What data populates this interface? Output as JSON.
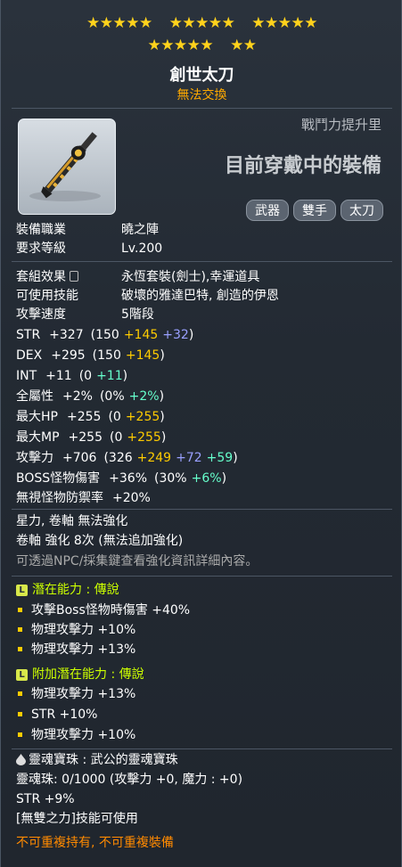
{
  "stars": {
    "row1": [
      "★★★★★",
      "★★★★★",
      "★★★★★"
    ],
    "row2": [
      "★★★★★",
      "★★"
    ]
  },
  "item": {
    "name": "創世太刀",
    "trade": "無法交換",
    "cp_label": "戰鬥力提升里",
    "equipped": "目前穿戴中的裝備",
    "tags": [
      "武器",
      "雙手",
      "太刀"
    ]
  },
  "req": [
    {
      "label": "裝備職業",
      "value": "曉之陣"
    },
    {
      "label": "要求等級",
      "value": "Lv.200"
    }
  ],
  "props": [
    {
      "label": "套組效果",
      "value": "永恆套裝(劍士),幸運道具"
    },
    {
      "label": "可使用技能",
      "value": "破壞的雅達巴特, 創造的伊恩"
    },
    {
      "label": "攻擊速度",
      "value": "5階段"
    }
  ],
  "stats": [
    {
      "label": "STR",
      "total": "+327",
      "open": "(150",
      "parts": [
        {
          "text": "+145",
          "c": "yel"
        },
        {
          "text": "+32",
          "c": "blu"
        }
      ],
      "close": ")"
    },
    {
      "label": "DEX",
      "total": "+295",
      "open": "(150",
      "parts": [
        {
          "text": "+145",
          "c": "yel"
        }
      ],
      "close": ")"
    },
    {
      "label": "INT",
      "total": "+11",
      "open": "(0",
      "parts": [
        {
          "text": "+11",
          "c": "grn"
        }
      ],
      "close": ")"
    },
    {
      "label": "全屬性",
      "total": "+2%",
      "open": "(0%",
      "parts": [
        {
          "text": "+2%",
          "c": "grn"
        }
      ],
      "close": ")"
    },
    {
      "label": "最大HP",
      "total": "+255",
      "open": "(0",
      "parts": [
        {
          "text": "+255",
          "c": "yel"
        }
      ],
      "close": ")"
    },
    {
      "label": "最大MP",
      "total": "+255",
      "open": "(0",
      "parts": [
        {
          "text": "+255",
          "c": "yel"
        }
      ],
      "close": ")"
    },
    {
      "label": "攻擊力",
      "total": "+706",
      "open": "(326",
      "parts": [
        {
          "text": "+249",
          "c": "yel"
        },
        {
          "text": "+72",
          "c": "blu"
        },
        {
          "text": "+59",
          "c": "grn"
        }
      ],
      "close": ")"
    },
    {
      "label": "BOSS怪物傷害",
      "total": "+36%",
      "open": "(30%",
      "parts": [
        {
          "text": "+6%",
          "c": "grn"
        }
      ],
      "close": ")"
    },
    {
      "label": "無視怪物防禦率",
      "total": "+20%",
      "open": "",
      "parts": [],
      "close": ""
    }
  ],
  "enhance": {
    "line1": "星力, 卷軸 無法強化",
    "line2": "卷軸 強化 8次 (無法追加強化)",
    "line3": "可透過NPC/採集鍵查看強化資訊詳細內容。"
  },
  "potential": {
    "badge": "L",
    "title": "潛在能力 : 傳說",
    "lines": [
      "攻擊Boss怪物時傷害 +40%",
      "物理攻擊力 +10%",
      "物理攻擊力 +13%"
    ]
  },
  "bonus_potential": {
    "badge": "L",
    "title": "附加潛在能力 : 傳說",
    "lines": [
      "物理攻擊力 +13%",
      "STR +10%",
      "物理攻擊力 +10%"
    ]
  },
  "soul": {
    "title": "靈魂寶珠 : 武公的靈魂寶珠",
    "gauge": "靈魂珠: 0/1000 (攻擊力 +0, 魔力 : +0)",
    "stat": "STR +9%",
    "skill": "[無雙之力]技能可使用"
  },
  "footer": "不可重複持有, 不可重複裝備",
  "colors": {
    "star": "#ffd21c",
    "trade": "#ffaa00",
    "potential": "#ccff00",
    "footer": "#ff8a00"
  }
}
